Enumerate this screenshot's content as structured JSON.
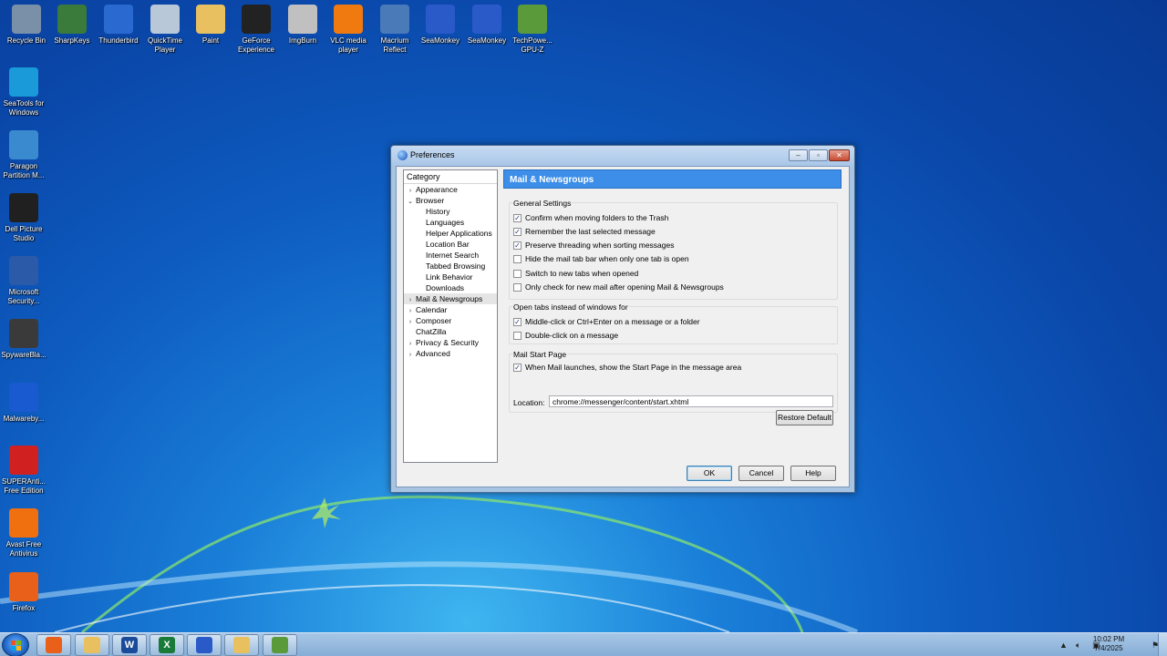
{
  "desktop_icons_top": [
    {
      "label": "Recycle Bin",
      "icon": "recycle-bin-icon",
      "color": "#7a8fa8"
    },
    {
      "label": "SharpKeys",
      "icon": "sharpkeys-icon",
      "color": "#3a7a3a"
    },
    {
      "label": "Thunderbird",
      "icon": "thunderbird-icon",
      "color": "#2a6ad0"
    },
    {
      "label": "QuickTime Player",
      "icon": "quicktime-icon",
      "color": "#b8c8d8"
    },
    {
      "label": "Paint",
      "icon": "paint-icon",
      "color": "#e8c060"
    },
    {
      "label": "GeForce Experience",
      "icon": "geforce-icon",
      "color": "#222222"
    },
    {
      "label": "ImgBurn",
      "icon": "imgburn-icon",
      "color": "#c0c0c0"
    },
    {
      "label": "VLC media player",
      "icon": "vlc-icon",
      "color": "#f07a10"
    },
    {
      "label": "Macrium Reflect",
      "icon": "macrium-icon",
      "color": "#4a7ab8"
    },
    {
      "label": "SeaMonkey",
      "icon": "seamonkey-icon",
      "color": "#2a5ac8"
    },
    {
      "label": "SeaMonkey",
      "icon": "seamonkey-icon",
      "color": "#2a5ac8"
    },
    {
      "label": "TechPowe... GPU-Z",
      "icon": "gpuz-icon",
      "color": "#5a9a3a"
    }
  ],
  "desktop_icons_left": [
    {
      "label": "SeaTools for Windows",
      "icon": "seatools-icon",
      "color": "#1a9ad8"
    },
    {
      "label": "Paragon Partition M...",
      "icon": "paragon-icon",
      "color": "#3a8ad0"
    },
    {
      "label": "Dell Picture Studio",
      "icon": "dell-picture-icon",
      "color": "#202020"
    },
    {
      "label": "Microsoft Security...",
      "icon": "ms-security-icon",
      "color": "#2a5aa8"
    },
    {
      "label": "SpywareBla...",
      "icon": "spywareblaster-icon",
      "color": "#3a3a3a"
    },
    {
      "label": "Malwareby...",
      "icon": "malwarebytes-icon",
      "color": "#1a5ad0"
    },
    {
      "label": "SUPERAnti... Free Edition",
      "icon": "superantispyware-icon",
      "color": "#d02020"
    },
    {
      "label": "Avast Free Antivirus",
      "icon": "avast-icon",
      "color": "#f07010"
    },
    {
      "label": "Firefox",
      "icon": "firefox-icon",
      "color": "#e8601a"
    }
  ],
  "dialog": {
    "title": "Preferences",
    "category_header": "Category",
    "tree": [
      {
        "label": "Appearance",
        "level": 1,
        "twisty": "›"
      },
      {
        "label": "Browser",
        "level": 1,
        "twisty": "⌄"
      },
      {
        "label": "History",
        "level": 2,
        "twisty": ""
      },
      {
        "label": "Languages",
        "level": 2,
        "twisty": ""
      },
      {
        "label": "Helper Applications",
        "level": 2,
        "twisty": ""
      },
      {
        "label": "Location Bar",
        "level": 2,
        "twisty": ""
      },
      {
        "label": "Internet Search",
        "level": 2,
        "twisty": ""
      },
      {
        "label": "Tabbed Browsing",
        "level": 2,
        "twisty": ""
      },
      {
        "label": "Link Behavior",
        "level": 2,
        "twisty": ""
      },
      {
        "label": "Downloads",
        "level": 2,
        "twisty": ""
      },
      {
        "label": "Mail & Newsgroups",
        "level": 1,
        "twisty": "›",
        "selected": true
      },
      {
        "label": "Calendar",
        "level": 1,
        "twisty": "›"
      },
      {
        "label": "Composer",
        "level": 1,
        "twisty": "›"
      },
      {
        "label": "ChatZilla",
        "level": 1,
        "twisty": ""
      },
      {
        "label": "Privacy & Security",
        "level": 1,
        "twisty": "›"
      },
      {
        "label": "Advanced",
        "level": 1,
        "twisty": "›"
      }
    ],
    "pane_title": "Mail & Newsgroups",
    "general": {
      "title": "General Settings",
      "options": [
        {
          "label": "Confirm when moving folders to the Trash",
          "checked": true
        },
        {
          "label": "Remember the last selected message",
          "checked": true
        },
        {
          "label": "Preserve threading when sorting messages",
          "checked": true
        },
        {
          "label": "Hide the mail tab bar when only one tab is open",
          "checked": false
        },
        {
          "label": "Switch to new tabs when opened",
          "checked": false
        },
        {
          "label": "Only check for new mail after opening Mail & Newsgroups",
          "checked": false
        }
      ]
    },
    "open_tabs": {
      "title": "Open tabs instead of windows for",
      "options": [
        {
          "label": "Middle-click or Ctrl+Enter on a message or a folder",
          "checked": true
        },
        {
          "label": "Double-click on a message",
          "checked": false
        }
      ]
    },
    "start_page": {
      "title": "Mail Start Page",
      "option": {
        "label": "When Mail launches, show the Start Page in the message area",
        "checked": true
      },
      "location_label": "Location:",
      "location_value": "chrome://messenger/content/start.xhtml",
      "restore_label": "Restore Default"
    },
    "ok_label": "OK",
    "cancel_label": "Cancel",
    "help_label": "Help",
    "check_glyph": "✓"
  },
  "taskbar": {
    "apps": [
      {
        "name": "firefox-taskbar",
        "glyph": "",
        "color": "#e8601a"
      },
      {
        "name": "explorer-taskbar",
        "glyph": "",
        "color": "#e8c060"
      },
      {
        "name": "word-taskbar",
        "glyph": "W",
        "color": "#1a4a9a"
      },
      {
        "name": "excel-taskbar",
        "glyph": "X",
        "color": "#1a7a3a"
      },
      {
        "name": "seamonkey-taskbar",
        "glyph": "",
        "color": "#2a5ac8"
      },
      {
        "name": "paint-taskbar",
        "glyph": "",
        "color": "#e8c060"
      },
      {
        "name": "gpuz-taskbar",
        "glyph": "",
        "color": "#5a9a3a"
      }
    ],
    "time": "10:02 PM",
    "date": "7/4/2025"
  }
}
